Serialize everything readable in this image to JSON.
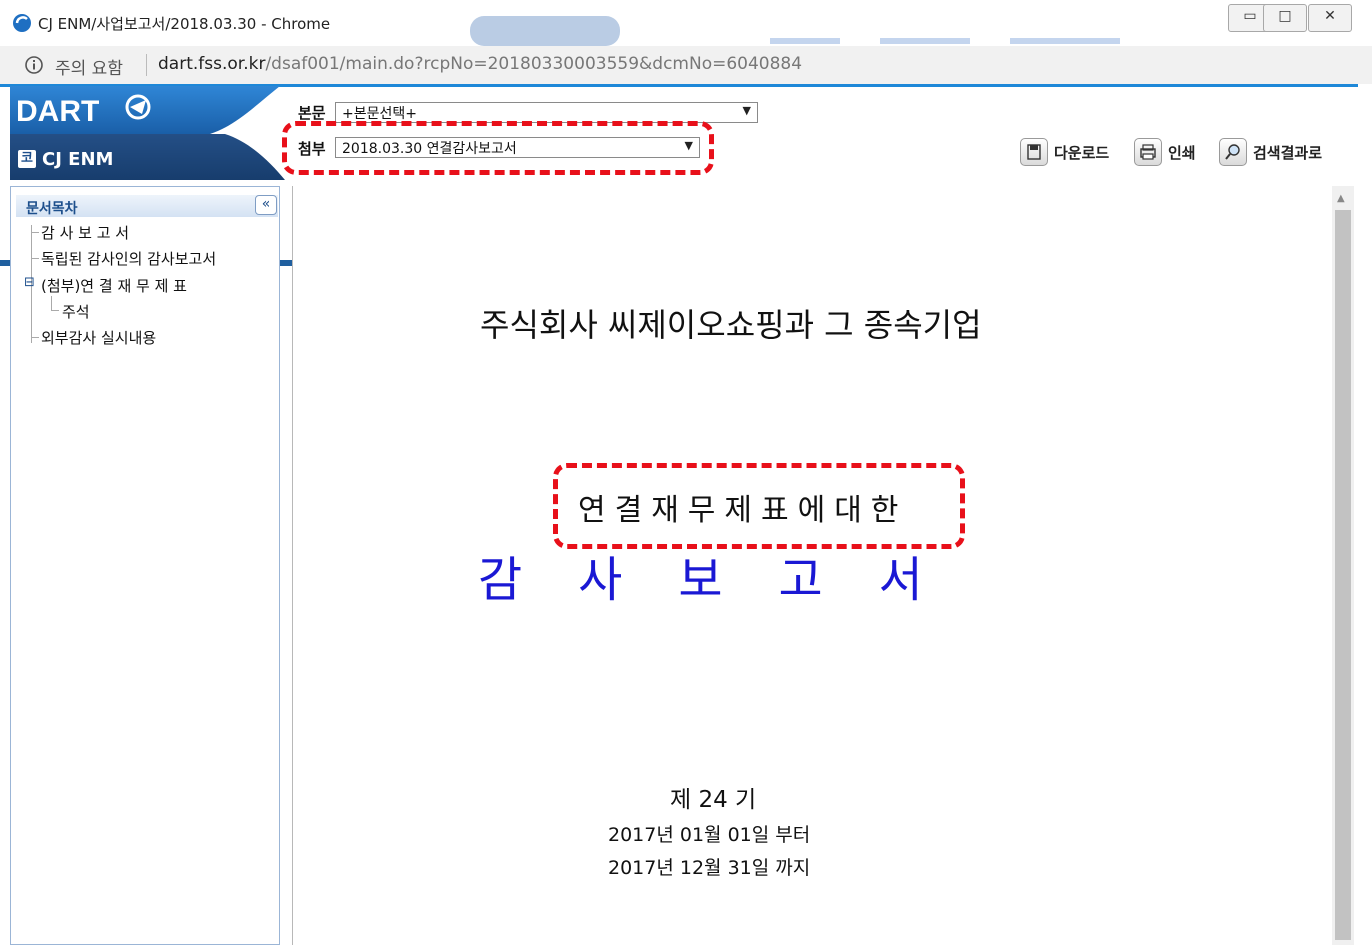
{
  "window": {
    "title": "CJ ENM/사업보고서/2018.03.30 - Chrome",
    "controls": {
      "minimize": "▭",
      "maximize": "□",
      "close": "✕"
    }
  },
  "address_bar": {
    "security_text": "주의 요함",
    "url_host": "dart.fss.or.kr",
    "url_path": "/dsaf001/main.do?rcpNo=20180330003559&dcmNo=6040884"
  },
  "header": {
    "logo_text": "DART",
    "company_icon": "코",
    "company_name": "CJ ENM",
    "body_select": {
      "label": "본문",
      "value": "+본문선택+"
    },
    "attach_select": {
      "label": "첨부",
      "value": "2018.03.30  연결감사보고서"
    },
    "toolbar": {
      "download_label": "다운로드",
      "print_label": "인쇄",
      "search_results_label": "검색결과로"
    }
  },
  "sidebar": {
    "title": "문서목차",
    "collapse_glyph": "«",
    "items": [
      {
        "label": "감 사 보 고 서"
      },
      {
        "label": "독립된 감사인의 감사보고서"
      },
      {
        "label": "(첨부)연 결 재 무 제 표",
        "toggle": "⊟"
      },
      {
        "label": "주석"
      },
      {
        "label": "외부감사 실시내용"
      }
    ]
  },
  "document": {
    "company": "주식회사 씨제이오쇼핑과 그 종속기업",
    "subtitle": "연결재무제표에대한",
    "main_title": "감사보고서",
    "period": "제 24 기",
    "from_date": "2017년 01월 01일  부터",
    "to_date": "2017년 12월 31일  까지"
  },
  "colors": {
    "accent_blue": "#1f5f9f",
    "highlight_red": "#e8101a",
    "title_blue": "#1a18d4"
  }
}
